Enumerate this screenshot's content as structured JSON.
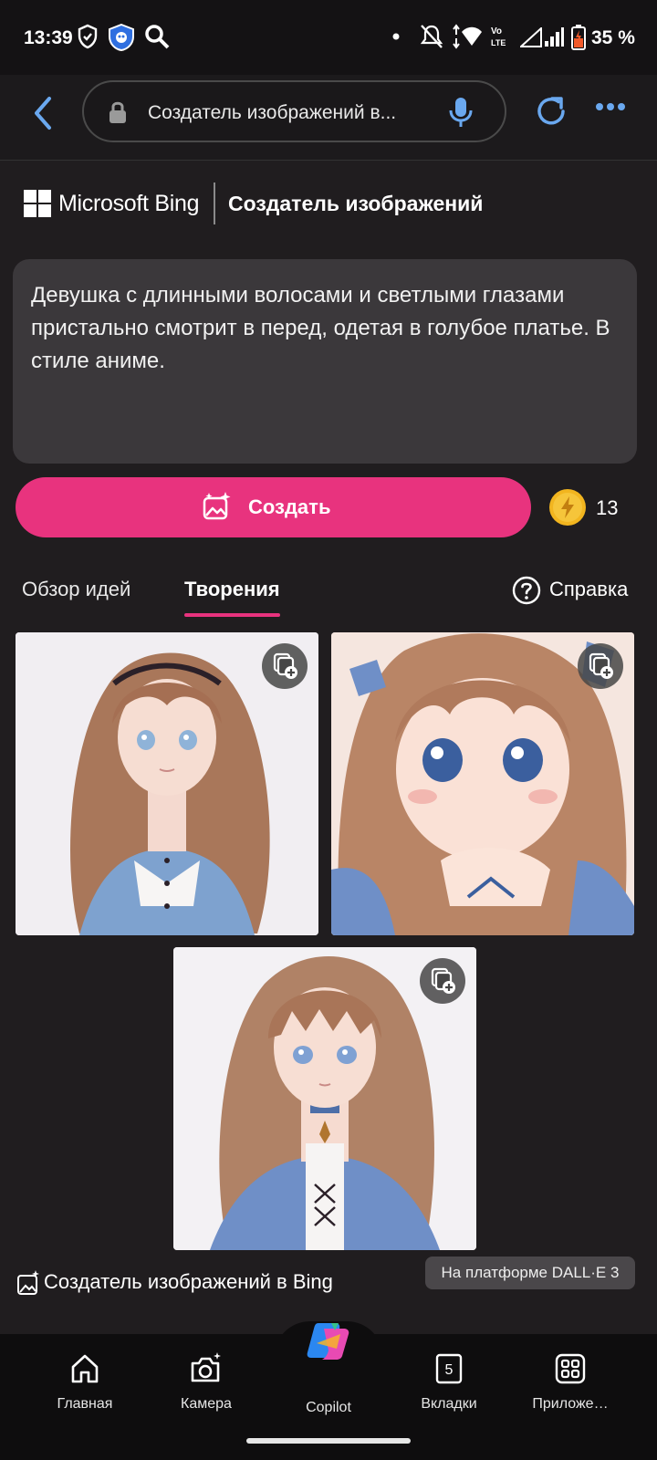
{
  "status_bar": {
    "time": "13:39",
    "battery": "35 %"
  },
  "address_bar": {
    "url_text": "Создатель изображений в..."
  },
  "header": {
    "brand": "Microsoft Bing",
    "title": "Создатель изображений"
  },
  "prompt": {
    "text": "Девушка с длинными волосами и светлыми глазами пристально смотрит в перед, одетая в голубое платье. В стиле аниме."
  },
  "create": {
    "button_label": "Создать",
    "boost_count": "13"
  },
  "tabs": [
    {
      "label": "Обзор идей",
      "active": false
    },
    {
      "label": "Творения",
      "active": true
    }
  ],
  "help_label": "Справка",
  "footer": {
    "label": "Создатель изображений в Bing",
    "badge": "На платформе DALL·E 3"
  },
  "bottom_nav": [
    {
      "label": "Главная",
      "icon": "home-icon"
    },
    {
      "label": "Камера",
      "icon": "camera-icon"
    },
    {
      "label": "Copilot",
      "icon": "copilot-icon"
    },
    {
      "label": "Вкладки",
      "icon": "tabs-icon",
      "count": "5"
    },
    {
      "label": "Приложе…",
      "icon": "apps-icon"
    }
  ],
  "colors": {
    "accent": "#e8337e",
    "background": "#201d1f",
    "link_blue": "#6aa8ef"
  }
}
